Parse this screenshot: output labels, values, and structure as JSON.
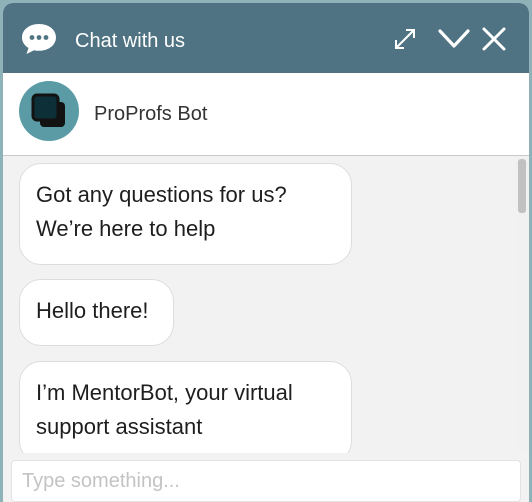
{
  "header": {
    "title": "Chat with us",
    "icons": {
      "chat": "chat-bubble-icon",
      "expand": "expand-icon",
      "minimize": "chevron-down-icon",
      "close": "close-icon"
    },
    "color": "#4f7382"
  },
  "bot": {
    "name": "ProProfs Bot",
    "avatar_icon": "overlapping-squares-icon",
    "avatar_color": "#5a9ba6"
  },
  "messages": [
    {
      "line1": "Got any questions for us?",
      "line2": "We’re here to help"
    },
    {
      "line1": "Hello there!"
    },
    {
      "line1": "I’m MentorBot, your virtual",
      "line2": "support assistant"
    }
  ],
  "composer": {
    "placeholder": "Type something...",
    "value": ""
  }
}
